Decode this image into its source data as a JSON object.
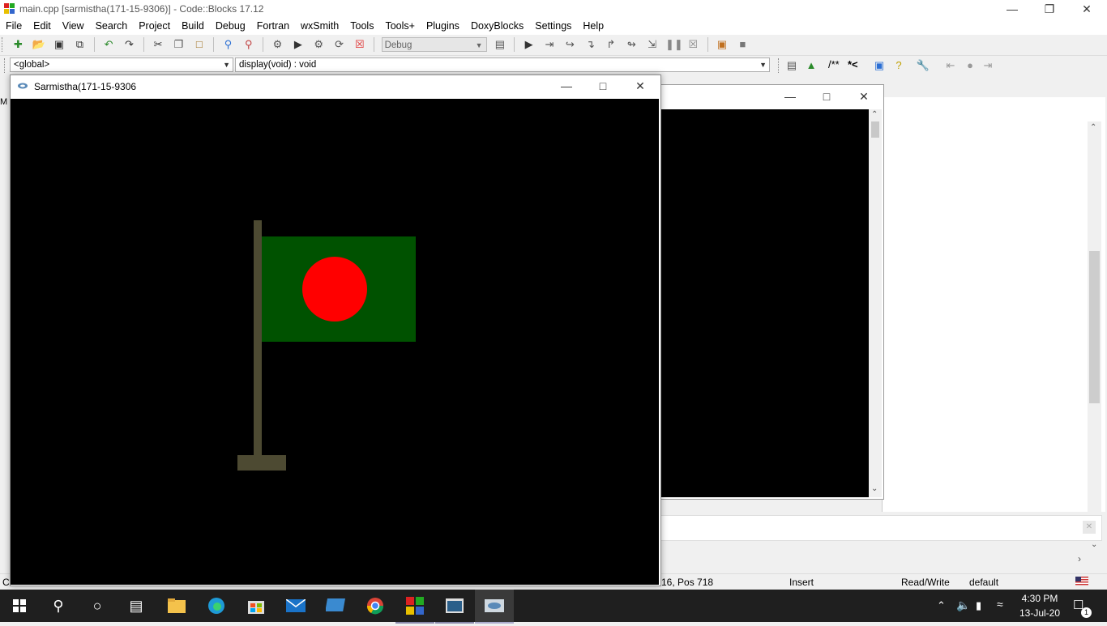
{
  "ide": {
    "window_title": "main.cpp [sarmistha(171-15-9306)] - Code::Blocks 17.12",
    "menu": [
      "File",
      "Edit",
      "View",
      "Search",
      "Project",
      "Build",
      "Debug",
      "Fortran",
      "wxSmith",
      "Tools",
      "Tools+",
      "Plugins",
      "DoxyBlocks",
      "Settings",
      "Help"
    ],
    "build_target": "Debug",
    "scope_combo": "<global>",
    "function_combo": "display(void) : void",
    "doxy_comment_block": "/**",
    "doxy_comment_line": "*<",
    "side_tab_label": "M",
    "status": {
      "left_text": "C",
      "position": "16, Pos 718",
      "mode": "Insert",
      "access": "Read/Write",
      "encoding": "default"
    }
  },
  "graphics_window": {
    "title": "Sarmistha(171-15-9306"
  },
  "scene": {
    "flag_field_color": "#005200",
    "flag_disc_color": "#ff0000",
    "pole_color": "#4d4a32",
    "background_color": "#000000"
  },
  "taskbar": {
    "time": "4:30 PM",
    "date": "13-Jul-20",
    "notification_count": "1"
  },
  "colors": {
    "taskbar_bg": "#1f1f1f",
    "accent": "#0078d7"
  }
}
